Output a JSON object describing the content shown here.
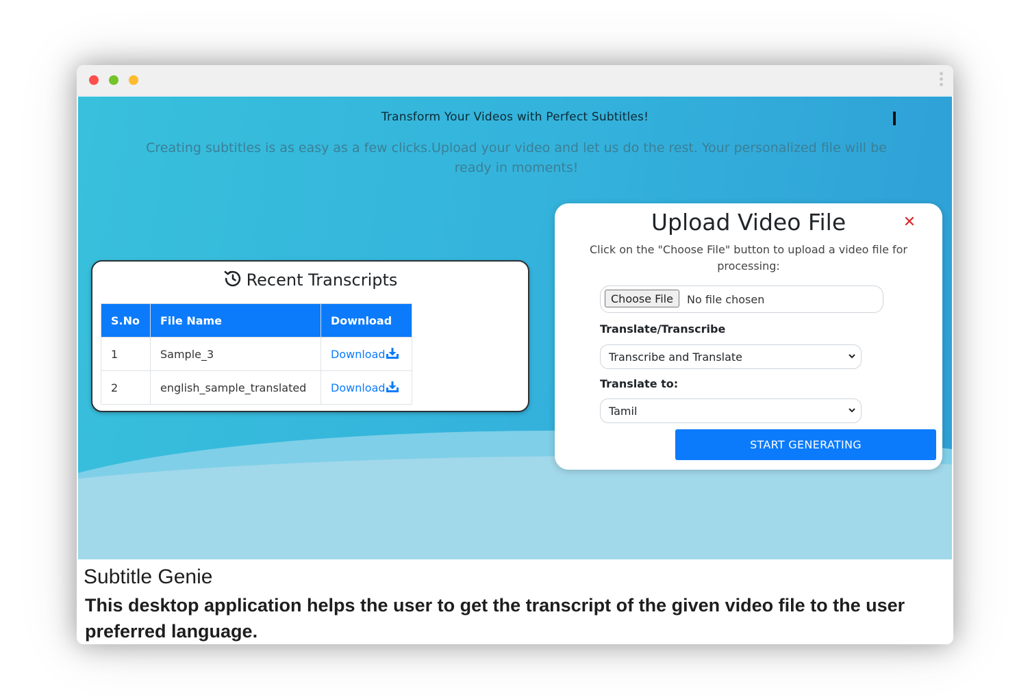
{
  "hero": {
    "title": "Transform Your Videos with Perfect Subtitles!",
    "subtitle": "Creating subtitles is as easy as a few clicks.Upload your video and let us do the rest. Your personalized file will be ready in moments!"
  },
  "recent": {
    "title": "Recent Transcripts",
    "icon": "history-icon",
    "columns": [
      "S.No",
      "File Name",
      "Download"
    ],
    "rows": [
      {
        "sno": "1",
        "file": "Sample_3",
        "download": "Download"
      },
      {
        "sno": "2",
        "file": "english_sample_translated",
        "download": "Download"
      }
    ]
  },
  "upload": {
    "title": "Upload Video File",
    "close_icon": "close-icon",
    "description": "Click on the \"Choose File\" button to upload a video file for processing:",
    "choose_file_label": "Choose File",
    "file_status": "No file chosen",
    "mode_label": "Translate/Transcribe",
    "mode_value": "Transcribe and Translate",
    "target_label": "Translate to:",
    "target_value": "Tamil",
    "start_label": "START GENERATING"
  },
  "caption": {
    "title": "Subtitle Genie",
    "text": "This desktop application helps the user to get the transcript of the given video file to the user preferred language."
  },
  "colors": {
    "accent": "#0b7bfb",
    "close": "#d8262a",
    "hero_bg": "#34b3dc"
  }
}
